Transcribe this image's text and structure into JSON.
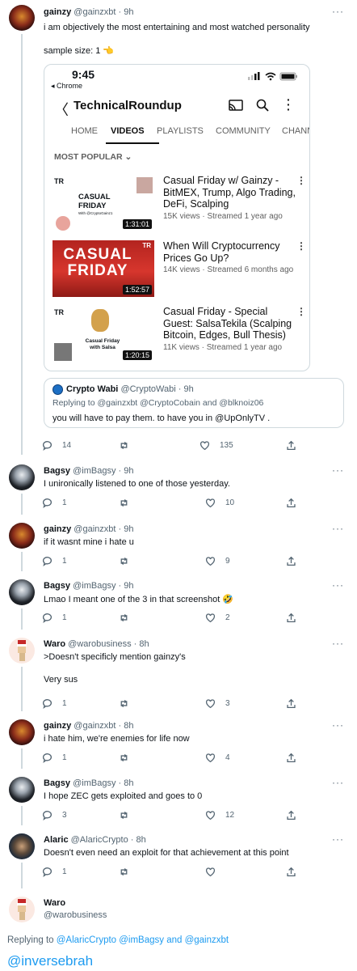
{
  "main_tweet": {
    "name": "gainzy",
    "handle": "@gainzxbt",
    "time": "9h",
    "more": "···",
    "text1": "i am objectively the most entertaining and most watched personality",
    "text2": "sample size: 1 👈",
    "phone": {
      "time": "9:45",
      "back_app": "◂ Chrome",
      "channel": "TechnicalRoundup",
      "tabs": [
        "HOME",
        "VIDEOS",
        "PLAYLISTS",
        "COMMUNITY",
        "CHANN"
      ],
      "active_tab": "VIDEOS",
      "sort": "MOST POPULAR",
      "videos": [
        {
          "title": "Casual Friday w/ Gainzy - BitMEX, Trump, Algo Trading, DeFi, Scalping",
          "meta": "15K views · Streamed 1 year ago",
          "duration": "1:31:01",
          "thumb_text": "CASUAL FRIDAY",
          "thumb_sub": "With @CryptoGainz1"
        },
        {
          "title": "When Will Cryptocurrency Prices Go Up?",
          "meta": "14K views · Streamed 6 months ago",
          "duration": "1:52:57",
          "thumb_text": "CASUAL FRIDAY"
        },
        {
          "title": "Casual Friday - Special Guest: SalsaTekila (Scalping Bitcoin, Edges, Bull Thesis)",
          "meta": "11K views · Streamed 1 year ago",
          "duration": "1:20:15",
          "thumb_text": "Casual Friday with Salsa"
        }
      ]
    },
    "quote": {
      "name": "Crypto Wabi",
      "handle": "@CryptoWabi",
      "time": "9h",
      "replying_prefix": "Replying to",
      "replying_to": "@gainzxbt @CryptoCobain and @blknoiz06",
      "text": "you will have to pay them. to have you in @UpOnlyTV ."
    },
    "replies": "14",
    "retweets": "",
    "likes": "135"
  },
  "replies": [
    {
      "name": "Bagsy",
      "handle": "@imBagsy",
      "time": "9h",
      "text": "I unironically listened to one of those yesterday.",
      "replies": "1",
      "likes": "10",
      "avatar": "bagsy"
    },
    {
      "name": "gainzy",
      "handle": "@gainzxbt",
      "time": "9h",
      "text": "if it wasnt mine i hate u",
      "replies": "1",
      "likes": "9",
      "avatar": "gainzy"
    },
    {
      "name": "Bagsy",
      "handle": "@imBagsy",
      "time": "9h",
      "text": "Lmao I meant one of the 3 in that screenshot 🤣",
      "replies": "1",
      "likes": "2",
      "avatar": "bagsy"
    },
    {
      "name": "Waro",
      "handle": "@warobusiness",
      "time": "8h",
      "text": ">Doesn't specificly mention gainzy's",
      "text2": "Very sus",
      "replies": "1",
      "likes": "3",
      "avatar": "waro"
    },
    {
      "name": "gainzy",
      "handle": "@gainzxbt",
      "time": "8h",
      "text": "i hate him, we're enemies for life now",
      "replies": "1",
      "likes": "4",
      "avatar": "gainzy"
    },
    {
      "name": "Bagsy",
      "handle": "@imBagsy",
      "time": "8h",
      "text": "I hope ZEC gets exploited and goes to 0",
      "replies": "3",
      "likes": "12",
      "avatar": "bagsy"
    },
    {
      "name": "Alaric",
      "handle": "@AlaricCrypto",
      "time": "8h",
      "text": "Doesn't even need an exploit for that achievement at this point",
      "replies": "1",
      "likes": "",
      "avatar": "alaric"
    }
  ],
  "composer": {
    "name": "Waro",
    "handle": "@warobusiness",
    "replying_prefix": "Replying to",
    "replying_to": "@AlaricCrypto @imBagsy and @gainzxbt",
    "watermark": "@inversebrah"
  },
  "colors": {
    "link": "#1d9bf0",
    "muted": "#536471",
    "yt_red": "#c4302b"
  }
}
